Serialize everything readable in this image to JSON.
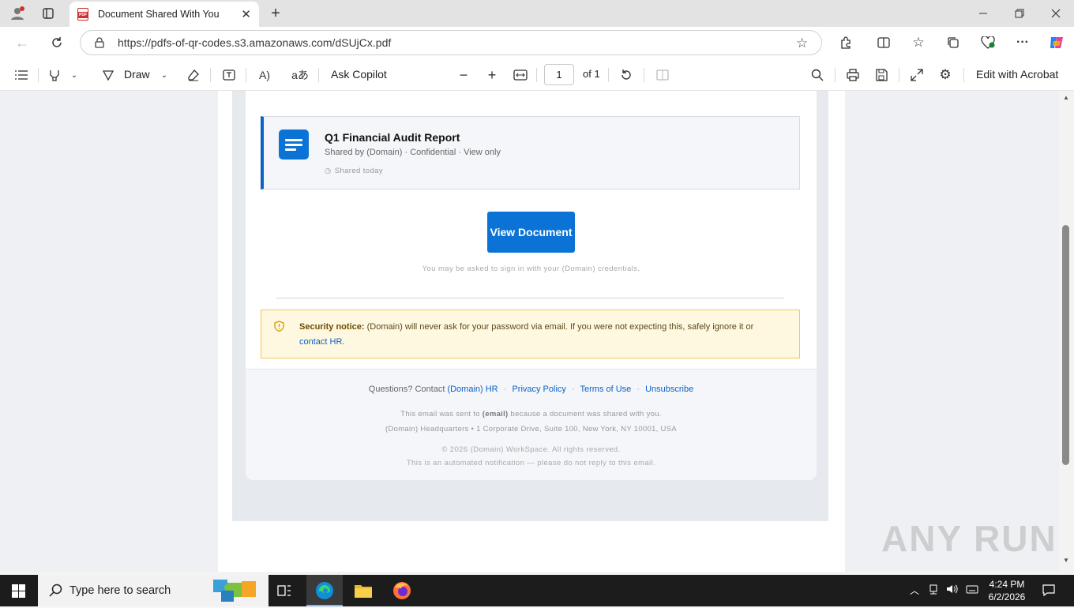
{
  "browser": {
    "tab_title": "Document Shared With You",
    "url": "https://pdfs-of-qr-codes.s3.amazonaws.com/dSUjCx.pdf"
  },
  "pdf_toolbar": {
    "draw_label": "Draw",
    "ask_copilot_label": "Ask Copilot",
    "page_value": "1",
    "page_total": "of 1",
    "edit_acrobat_label": "Edit with Acrobat"
  },
  "email": {
    "doc_title": "Q1 Financial Audit Report",
    "doc_meta": "Shared by (Domain) · Confidential · View only",
    "doc_date": "Shared today",
    "view_button": "View Document",
    "signin_note": "You may be asked to sign in with your (Domain) credentials.",
    "notice_bold": "Security notice:",
    "notice_text": "(Domain) will never ask for your password via email. If you were not expecting this, safely ignore it or",
    "notice_link": "contact HR",
    "notice_end": ".",
    "footer": {
      "questions": "Questions? Contact",
      "hr_link": "(Domain) HR",
      "privacy": "Privacy Policy",
      "terms": "Terms of Use",
      "unsubscribe": "Unsubscribe",
      "sent_pre": "This email was sent to",
      "sent_email": "(email)",
      "sent_post": "because a document was shared with you.",
      "address": "(Domain) Headquarters • 1 Corporate Drive, Suite 100, New York, NY 10001, USA",
      "copyright": "© 2026 (Domain) WorkSpace. All rights reserved.",
      "automated": "This is an automated notification — please do not reply to this email."
    }
  },
  "taskbar": {
    "search_placeholder": "Type here to search",
    "time": "4:24 PM",
    "date": "6/2/2026"
  },
  "watermark": "ANY RUN"
}
